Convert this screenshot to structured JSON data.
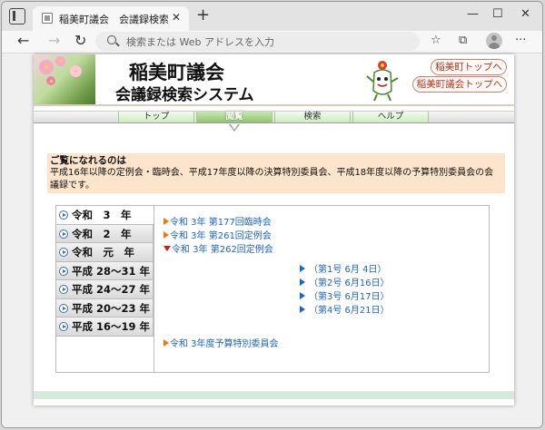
{
  "browser": {
    "tab_title": "稲美町議会　会議録検索システム",
    "tab_close": "✕",
    "new_tab": "+",
    "minimize": "—",
    "maximize": "☐",
    "close": "✕",
    "back": "←",
    "forward": "→",
    "refresh": "↻",
    "address_placeholder": "検索または Web アドレスを入力",
    "favorites_icon": "☆",
    "collections_icon": "⧉",
    "more_icon": "···"
  },
  "header": {
    "title": "稲美町議会",
    "subtitle": "会議録検索システム",
    "link_town_top": "稲美町トップへ",
    "link_system_top": "稲美町議会トップへ"
  },
  "nav": {
    "items": [
      "トップ",
      "閲覧",
      "検索",
      "ヘルプ"
    ],
    "active_index": 1
  },
  "info": {
    "title": "ご覧になれるのは",
    "text": "平成16年以降の定例会・臨時会、平成17年度以降の決算特別委員会、平成18年度以降の予算特別委員会の会議録です。"
  },
  "eras": [
    {
      "label": "令和　3　年"
    },
    {
      "label": "令和　2　年"
    },
    {
      "label": "令和　元　年"
    },
    {
      "label": "平成 28～31 年"
    },
    {
      "label": "平成 24～27 年"
    },
    {
      "label": "平成 20～23 年"
    },
    {
      "label": "平成 16～19 年"
    }
  ],
  "meetings": [
    {
      "label": "令和 3年 第177回臨時会",
      "expanded": false
    },
    {
      "label": "令和 3年 第261回定例会",
      "expanded": false
    },
    {
      "label": "令和 3年 第262回定例会",
      "expanded": true
    }
  ],
  "sessions": [
    "（第1号  6月  4日）",
    "（第2号  6月16日）",
    "（第3号  6月17日）",
    "（第4号  6月21日）"
  ],
  "committee": "令和 3年度予算特別委員会",
  "colors": {
    "accent_green": "#8fc570",
    "link_blue": "#1e64c8",
    "info_bg": "#fde4cc",
    "header_link_red": "#b2331b"
  }
}
